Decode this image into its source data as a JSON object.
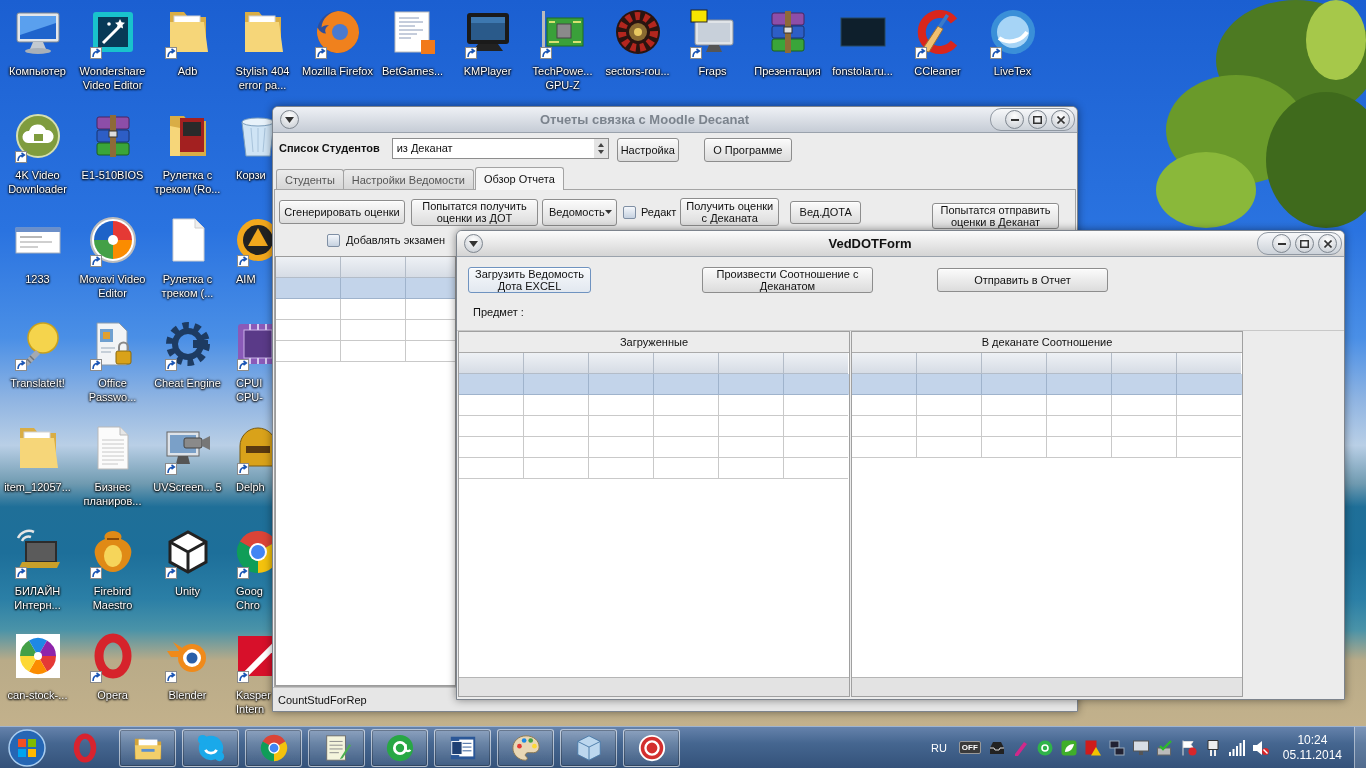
{
  "desktop": {
    "columns": [
      [
        {
          "label": "Компьютер",
          "kind": "computer",
          "shortcut": false
        },
        {
          "label": "4K Video Downloader",
          "kind": "cloud",
          "shortcut": true
        },
        {
          "label": "1233",
          "kind": "screenshot",
          "shortcut": false
        },
        {
          "label": "TranslateIt!",
          "kind": "bulb",
          "shortcut": true
        },
        {
          "label": "item_12057...",
          "kind": "folder",
          "shortcut": false
        },
        {
          "label": "БИЛАЙН Интерн...",
          "kind": "laptop",
          "shortcut": true
        },
        {
          "label": "can-stock-...",
          "kind": "colorwheel",
          "shortcut": false
        }
      ],
      [
        {
          "label": "Wondershare Video Editor",
          "kind": "film",
          "shortcut": true
        },
        {
          "label": "E1-510BIOS",
          "kind": "archive",
          "shortcut": false
        },
        {
          "label": "Movavi Video Editor",
          "kind": "pinwheel",
          "shortcut": true
        },
        {
          "label": "Office Passwo...",
          "kind": "lockdoc",
          "shortcut": true
        },
        {
          "label": "Бизнес планиров...",
          "kind": "textdoc",
          "shortcut": false
        },
        {
          "label": "Firebird Maestro",
          "kind": "vase",
          "shortcut": true
        },
        {
          "label": "Opera",
          "kind": "opera",
          "shortcut": true
        }
      ],
      [
        {
          "label": "Adb",
          "kind": "folder",
          "shortcut": true
        },
        {
          "label": "Рулетка с треком (Ro...",
          "kind": "photofolder",
          "shortcut": false
        },
        {
          "label": "Рулетка с треком (...",
          "kind": "blankdoc",
          "shortcut": false
        },
        {
          "label": "Cheat Engine",
          "kind": "gear",
          "shortcut": true
        },
        {
          "label": "UVScreen... 5",
          "kind": "camera",
          "shortcut": true
        },
        {
          "label": "Unity",
          "kind": "unity",
          "shortcut": true
        },
        {
          "label": "Blender",
          "kind": "blender",
          "shortcut": true
        }
      ],
      [
        {
          "label": "Stylish 404 error pa...",
          "kind": "folder",
          "shortcut": false
        },
        {
          "label": "Корзи",
          "kind": "trash",
          "shortcut": false
        },
        {
          "label": "AIM",
          "kind": "aimp",
          "shortcut": true
        },
        {
          "label": "CPUI CPU-",
          "kind": "cpu",
          "shortcut": true
        },
        {
          "label": "Delph",
          "kind": "delphi",
          "shortcut": true
        },
        {
          "label": "Goog Chro",
          "kind": "chrome",
          "shortcut": true
        },
        {
          "label": "Kasper Intern",
          "kind": "kaspersky",
          "shortcut": true
        }
      ],
      [
        {
          "label": "Mozilla Firefox",
          "kind": "firefox",
          "shortcut": true
        }
      ],
      [
        {
          "label": "BetGames...",
          "kind": "htmldoc",
          "shortcut": false
        }
      ],
      [
        {
          "label": "KMPlayer",
          "kind": "kmp",
          "shortcut": true
        }
      ],
      [
        {
          "label": "TechPowe... GPU-Z",
          "kind": "board",
          "shortcut": true
        }
      ],
      [
        {
          "label": "sectors-rou...",
          "kind": "roulette",
          "shortcut": false
        }
      ],
      [
        {
          "label": "Fraps",
          "kind": "fraps",
          "shortcut": true
        }
      ],
      [
        {
          "label": "Презентация",
          "kind": "archive",
          "shortcut": false
        }
      ],
      [
        {
          "label": "fonstola.ru...",
          "kind": "darkimage",
          "shortcut": false
        }
      ],
      [
        {
          "label": "CCleaner",
          "kind": "ccleaner",
          "shortcut": true
        }
      ],
      [
        {
          "label": "LiveTex",
          "kind": "livetex",
          "shortcut": true
        }
      ]
    ]
  },
  "main_window": {
    "title": "Отчеты связка с Moodle Decanat",
    "active": false,
    "students_label": "Список Студентов",
    "source_combo": {
      "value": "из Деканат"
    },
    "buttons": [
      "Настройка",
      "О Программе"
    ],
    "tabs": [
      {
        "label": "Студенты",
        "selected": false
      },
      {
        "label": "Настройки Ведомости",
        "selected": false
      },
      {
        "label": "Обзор Отчета",
        "selected": true
      }
    ],
    "toolbar": [
      {
        "kind": "button",
        "label": "Сгенерировать оценки"
      },
      {
        "kind": "button",
        "label": "Попытатся получить оценки из ДОТ"
      },
      {
        "kind": "dropdown",
        "label": "Ведомость"
      },
      {
        "kind": "checkbox",
        "label": "Редакт",
        "checked": false
      },
      {
        "kind": "button",
        "label": "Получить оценки с Деканата"
      },
      {
        "kind": "button",
        "label": "Вед.ДОТА"
      },
      {
        "kind": "button",
        "label": "Попытатся отправить оценки в Деканат"
      }
    ],
    "exam_checkbox": {
      "label": "Добавлять экзамен",
      "checked": false
    },
    "table": {
      "rows": [
        {
          "selected": true
        },
        {
          "selected": false
        },
        {
          "selected": false
        },
        {
          "selected": false
        }
      ]
    },
    "status_bar": "CountStudForRep"
  },
  "form_window": {
    "title": "VedDOTForm",
    "active": true,
    "buttons": [
      {
        "label": "Загрузить Ведомость Дота EXCEL",
        "focused": true
      },
      {
        "label": "Произвести Соотношение с Деканатом",
        "focused": false
      },
      {
        "label": "Отправить в Отчет",
        "focused": false
      }
    ],
    "subject_label": "Предмет :",
    "panels": [
      {
        "title": "Загруженные",
        "rows": [
          {
            "selected": true
          },
          {
            "selected": false
          },
          {
            "selected": false
          },
          {
            "selected": false
          },
          {
            "selected": false
          }
        ]
      },
      {
        "title": "В деканате Соотношение",
        "rows": [
          {
            "selected": true
          },
          {
            "selected": false
          },
          {
            "selected": false
          },
          {
            "selected": false
          }
        ]
      }
    ]
  },
  "taskbar": {
    "items": [
      {
        "kind": "opera",
        "running": false
      },
      {
        "kind": "explorer",
        "running": true
      },
      {
        "kind": "skype",
        "running": true
      },
      {
        "kind": "chrome",
        "running": true
      },
      {
        "kind": "notepad",
        "running": true
      },
      {
        "kind": "mail",
        "running": true
      },
      {
        "kind": "word",
        "running": true
      },
      {
        "kind": "paint",
        "running": true
      },
      {
        "kind": "cube",
        "running": true
      },
      {
        "kind": "dapp",
        "running": true
      }
    ],
    "language": "RU",
    "tray_badge": "OFF",
    "time": "10:24",
    "date": "05.11.2014"
  }
}
